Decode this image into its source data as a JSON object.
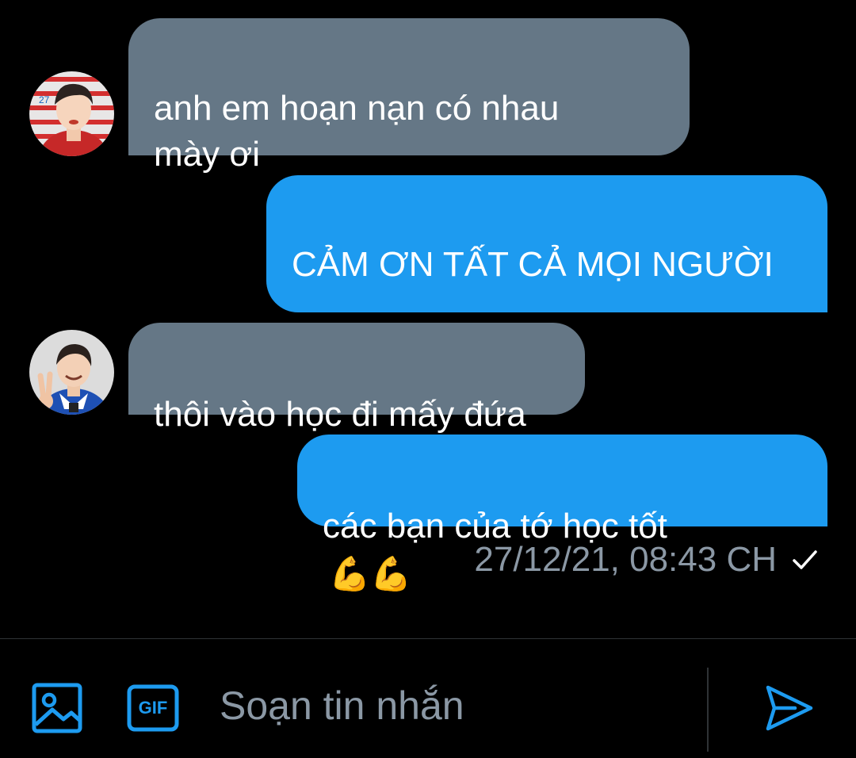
{
  "messages": [
    {
      "direction": "received",
      "text": "anh em hoạn nạn có nhau\nmày ơi",
      "avatar": "avatar-user-1"
    },
    {
      "direction": "sent",
      "text": "CẢM ƠN TẤT CẢ MỌI NGƯỜI",
      "emoji": "🙏🙏🙏"
    },
    {
      "direction": "received",
      "text": "thôi vào học đi mấy đứa",
      "avatar": "avatar-user-2"
    },
    {
      "direction": "sent",
      "text": "các bạn của tớ học tốt",
      "emoji": "💪💪"
    }
  ],
  "status": {
    "timestamp": "27/12/21, 08:43 CH",
    "read_icon": "check-icon"
  },
  "composer": {
    "placeholder": "Soạn tin nhắn",
    "image_icon": "image-icon",
    "gif_label": "GIF",
    "send_icon": "send-icon"
  },
  "colors": {
    "background": "#000000",
    "received_bubble": "#657786",
    "sent_bubble": "#1d9bf0",
    "accent": "#1d9bf0",
    "muted_text": "#8b98a5"
  }
}
